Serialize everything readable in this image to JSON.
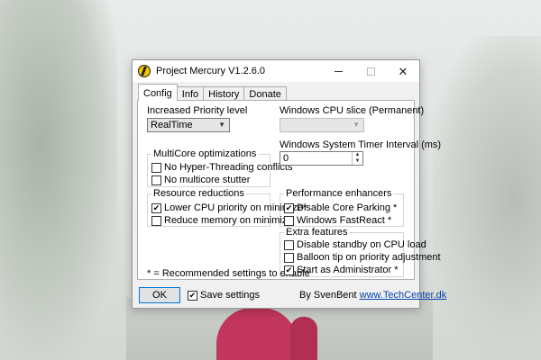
{
  "window": {
    "title": "Project Mercury V1.2.6.0"
  },
  "tabs": [
    {
      "label": "Config",
      "active": true
    },
    {
      "label": "Info",
      "active": false
    },
    {
      "label": "History",
      "active": false
    },
    {
      "label": "Donate",
      "active": false
    }
  ],
  "config": {
    "priority_label": "Increased Priority level",
    "priority_value": "RealTime",
    "cpu_slice_label": "Windows CPU slice (Permanent)",
    "cpu_slice_value": "",
    "timer_label": "Windows System Timer Interval (ms)",
    "timer_value": "0",
    "multicore": {
      "title": "MultiCore optimizations",
      "items": [
        {
          "label": "No Hyper-Threading conflicts",
          "checked": false
        },
        {
          "label": "No multicore stutter",
          "checked": false
        }
      ]
    },
    "resource": {
      "title": "Resource reductions",
      "items": [
        {
          "label": "Lower CPU priority on minimize*",
          "checked": true
        },
        {
          "label": "Reduce memory on minimize",
          "checked": false
        }
      ]
    },
    "performance": {
      "title": "Performance enhancers",
      "items": [
        {
          "label": "Disable Core Parking *",
          "checked": true
        },
        {
          "label": "Windows FastReact *",
          "checked": false
        }
      ]
    },
    "extra": {
      "title": "Extra features",
      "items": [
        {
          "label": "Disable standby on CPU load",
          "checked": false
        },
        {
          "label": "Balloon tip on priority adjustment",
          "checked": false
        },
        {
          "label": "Start as Administrator *",
          "checked": true
        }
      ]
    },
    "note": "* = Recommended settings to enable"
  },
  "footer": {
    "ok_label": "OK",
    "save_label": "Save settings",
    "save_checked": true,
    "by_text": "By SvenBent",
    "link_text": "www.TechCenter.dk"
  },
  "icons": {
    "app": "mercury-app-icon",
    "minimize": "minimize-icon",
    "maximize": "maximize-icon",
    "close": "close-icon"
  },
  "colors": {
    "link": "#0645ad",
    "ok_border": "#0078d7"
  }
}
